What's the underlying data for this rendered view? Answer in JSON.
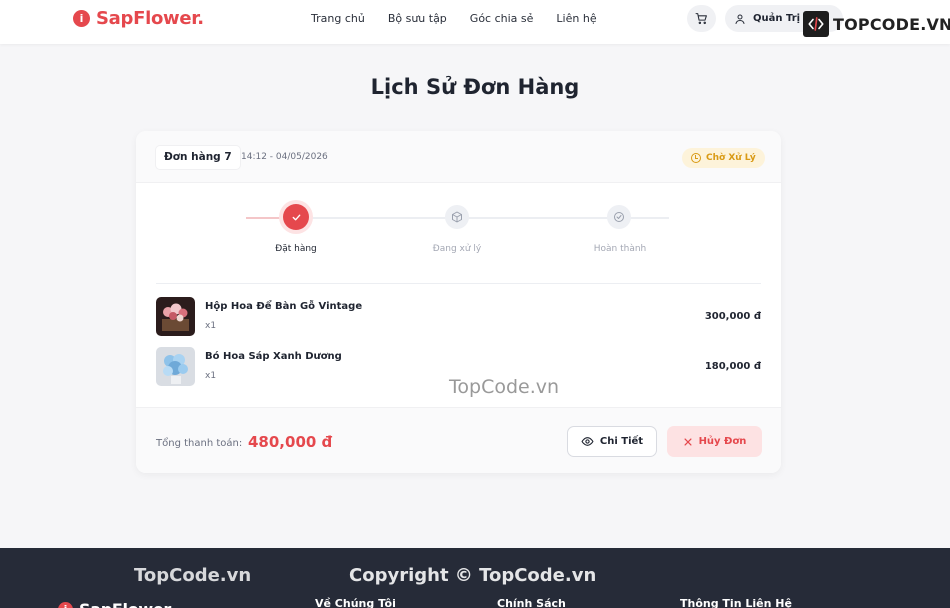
{
  "header": {
    "brand": "SapFlower.",
    "nav": [
      "Trang chủ",
      "Bộ sưu tập",
      "Góc chia sẻ",
      "Liên hệ"
    ],
    "user_name": "Quản Trị V",
    "watermark_logo": "TOPCODE.VN"
  },
  "page_title": "Lịch Sử Đơn Hàng",
  "order": {
    "id_label": "Đơn hàng 7",
    "time": "14:12 - 04/05/2026",
    "status": "Chờ Xử Lý",
    "steps": [
      {
        "label": "Đặt hàng",
        "state": "done"
      },
      {
        "label": "Đang xử lý",
        "state": "pending"
      },
      {
        "label": "Hoàn thành",
        "state": "pending"
      }
    ],
    "items": [
      {
        "name": "Hộp Hoa Để Bàn Gỗ Vintage",
        "qty": "x1",
        "price": "300,000 đ"
      },
      {
        "name": "Bó Hoa Sáp Xanh Dương",
        "qty": "x1",
        "price": "180,000 đ"
      }
    ],
    "total_label": "Tổng thanh toán:",
    "total_value": "480,000 đ",
    "detail_button": "Chi Tiết",
    "cancel_button": "Hủy Đơn"
  },
  "watermarks": {
    "middle": "TopCode.vn",
    "footer_left": "TopCode.vn",
    "footer_center": "Copyright © TopCode.vn"
  },
  "footer": {
    "brand": "SapFlower.",
    "columns": [
      "Về Chúng Tôi",
      "Chính Sách",
      "Thông Tin Liên Hệ"
    ]
  },
  "colors": {
    "accent": "#e5484d",
    "status_pending": "#d99a14",
    "footer_bg": "#262b38"
  }
}
